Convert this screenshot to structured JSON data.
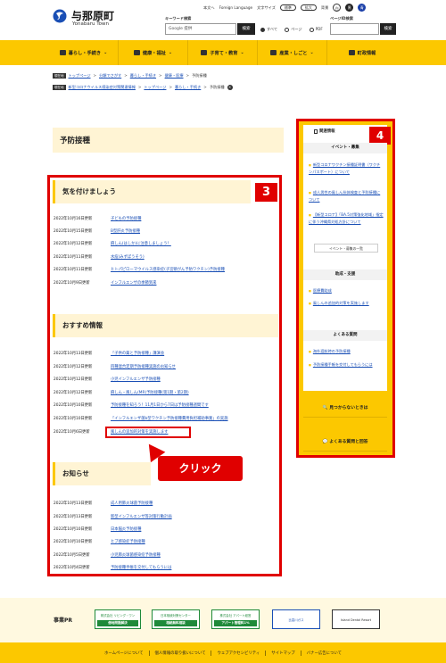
{
  "header": {
    "logo_ja": "与那原町",
    "logo_en": "Yonabaru Town",
    "util": {
      "home": "本文へ",
      "foreign": "Foreign Language",
      "font_size": "文字サイズ",
      "std": "標準",
      "large": "拡大",
      "bg": "背景",
      "white": "白",
      "black": "黒",
      "blue": "青"
    },
    "keyword_label": "キーワード検索",
    "keyword_placeholder": "Google 提供",
    "search_button": "検索",
    "radio_all": "すべて",
    "radio_page": "ページ",
    "radio_pdf": "PDF",
    "page_id_label": "ページID検索",
    "page_id_button": "検索"
  },
  "nav": [
    {
      "label": "暮らし・手続き"
    },
    {
      "label": "健康・福祉"
    },
    {
      "label": "子育て・教育"
    },
    {
      "label": "産業・しごと"
    },
    {
      "label": "町政情報"
    }
  ],
  "breadcrumbs": [
    {
      "tag": "現在地",
      "items": [
        "トップページ",
        "分類でさがす",
        "暮らし・手続き",
        "健康・医療",
        "予防接種"
      ]
    },
    {
      "tag": "現在地",
      "items": [
        "新型コロナウイルス感染症対策関連情報",
        "トップページ",
        "暮らし・手続き",
        "予防接種"
      ]
    }
  ],
  "page_title": "予防接種",
  "sections": {
    "careful": {
      "title": "気を付けましょう",
      "items": [
        {
          "date": "2022年10月16日更新",
          "title": "子どもの予防接種"
        },
        {
          "date": "2022年10月15日更新",
          "title": "B型肝炎予防接種"
        },
        {
          "date": "2022年10月12日更新",
          "title": "麻しん(はしか)に注意しましょう！"
        },
        {
          "date": "2022年10月11日更新",
          "title": "水痘(みずぼうそう)"
        },
        {
          "date": "2022年10月11日更新",
          "title": "ヒトパピローマウイルス感染症(子宮頸がん予防ワクチン)予防接種"
        },
        {
          "date": "2022年10月9日更新",
          "title": "インフルエンザの季節到来"
        }
      ]
    },
    "recommended": {
      "title": "おすすめ情報",
      "items": [
        {
          "date": "2022年10月13日更新",
          "title": "「子供の薬と予防接種」講演会"
        },
        {
          "date": "2022年10月12日更新",
          "title": "四種混合定期予防接種実施のお知らせ"
        },
        {
          "date": "2022年10月12日更新",
          "title": "小児インフルエンザ予防接種"
        },
        {
          "date": "2022年10月12日更新",
          "title": "麻しん・風しん(MR)予防接種(第1期・第2期)"
        },
        {
          "date": "2022年10月10日更新",
          "title": "予防接種を知ろう！11月1日から7日は予防接種週間です"
        },
        {
          "date": "2022年10月10日更新",
          "title": "「インフルエンザ菌b型ワクチン予防接種費用負担補助事業」の実施"
        },
        {
          "date": "2022年10月6日更新",
          "title": "風しんの追加的対策を実施します"
        }
      ]
    },
    "notices": {
      "title": "お知らせ",
      "items": [
        {
          "date": "2022年10月13日更新",
          "title": "成人用肺炎球菌予防接種"
        },
        {
          "date": "2022年10月13日更新",
          "title": "新型インフルエンザ等対策行動計画"
        },
        {
          "date": "2022年10月10日更新",
          "title": "日本脳炎予防接種"
        },
        {
          "date": "2022年10月10日更新",
          "title": "ヒブ感染症予防接種"
        },
        {
          "date": "2022年10月5日更新",
          "title": "小児肺炎球菌感染症予防接種"
        },
        {
          "date": "2022年10月4日更新",
          "title": "予防接種手帳を交付してもらうには"
        }
      ]
    }
  },
  "annotations": {
    "badge_main": "3",
    "badge_side": "4",
    "click_callout": "クリック"
  },
  "sidebar": {
    "related_label": "関連情報",
    "events_title": "イベント・募集",
    "event_links": [
      "新型コロナワクチン接種証明書（ワクチンパスポート）について",
      "成人男性の風しん抗体検査と予防接種について",
      "【新型コロナ】「BA.5対策強化地域」指定に伴う沖縄県対処方針について"
    ],
    "event_list_button": "イベント・募集の一覧",
    "subsidy_title": "助成・支援",
    "subsidy_links": [
      "医療費助成",
      "風しんの追加的対策を実施します"
    ],
    "faq_title": "よくある質問",
    "faq_links": [
      "海外渡航時の予防接種",
      "予防接種手帳を交付してもらうには"
    ],
    "cta_notfound": "見つからないときは",
    "cta_faq": "よくある質問と回答"
  },
  "pr": {
    "label": "事業PR",
    "logos": [
      {
        "top": "株式会社 リビング・ワン",
        "bottom": "借地問題解決"
      },
      {
        "top": "日本相続対策センター",
        "bottom": "相続無料相談"
      },
      {
        "top": "株式会社 アパート経営",
        "bottom": "アパート管理料1%"
      },
      {
        "top": "比嘉川ガス",
        "bottom": ""
      },
      {
        "top": "Island Dental Resort",
        "bottom": ""
      }
    ]
  },
  "footer": {
    "links": [
      "ホームページについて",
      "個人情報の取り扱いについて",
      "ウェブアクセシビリティ",
      "サイトマップ",
      "バナー広告について"
    ]
  },
  "colors": {
    "brand_yellow": "#fcc800",
    "annotation_red": "#e00000",
    "link_blue": "#1a4fb5",
    "section_bg": "#fff4d4"
  }
}
